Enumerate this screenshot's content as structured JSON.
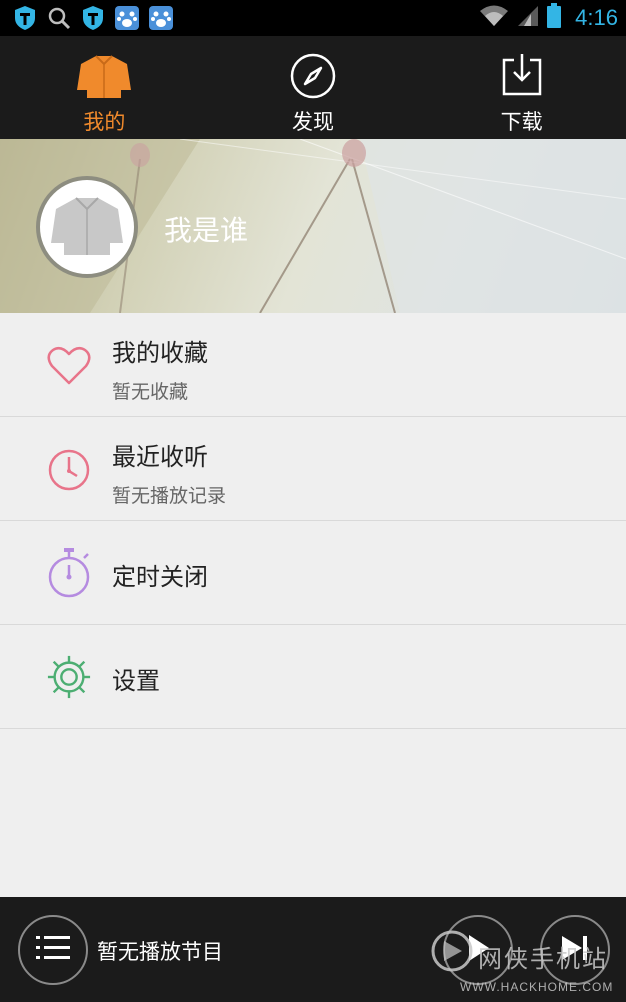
{
  "status_bar": {
    "time": "4:16",
    "left_icons": [
      "shield-icon",
      "search-icon",
      "shield-icon",
      "baidu-paw-icon",
      "baidu-paw-icon"
    ],
    "right_icons": [
      "wifi-icon",
      "signal-icon",
      "battery-icon"
    ]
  },
  "tabs": [
    {
      "label": "我的",
      "icon": "shirt-icon",
      "active": true
    },
    {
      "label": "发现",
      "icon": "compass-icon",
      "active": false
    },
    {
      "label": "下载",
      "icon": "download-icon",
      "active": false
    }
  ],
  "profile": {
    "name": "我是谁",
    "avatar_icon": "shirt-icon"
  },
  "menu": [
    {
      "title": "我的收藏",
      "subtitle": "暂无收藏",
      "icon": "heart-icon",
      "color": "#e8748a"
    },
    {
      "title": "最近收听",
      "subtitle": "暂无播放记录",
      "icon": "clock-icon",
      "color": "#e8748a"
    },
    {
      "title": "定时关闭",
      "icon": "stopwatch-icon",
      "color": "#b58be0"
    },
    {
      "title": "设置",
      "icon": "gear-icon",
      "color": "#4cae72"
    }
  ],
  "player": {
    "now_playing": "暂无播放节目",
    "icons": [
      "playlist-icon",
      "play-icon",
      "next-icon"
    ]
  },
  "watermark": {
    "text": "网侠手机站",
    "url": "WWW.HACKHOME.COM"
  },
  "colors": {
    "accent": "#f08a2c",
    "status_blue": "#33b5e5",
    "dark_bar": "#1b1b1b"
  }
}
